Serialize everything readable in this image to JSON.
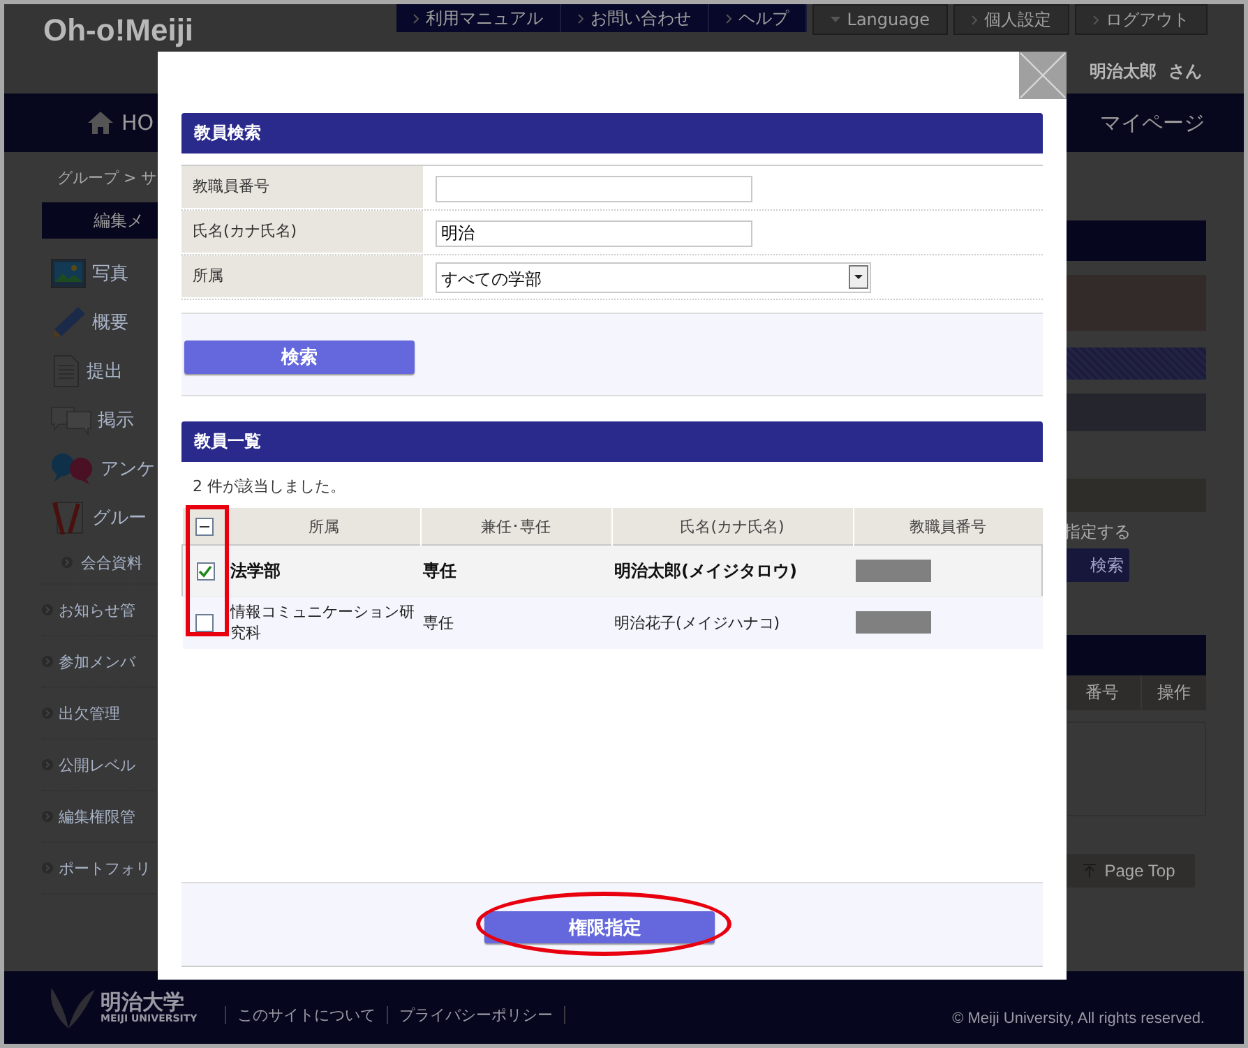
{
  "top_links": [
    {
      "label": "利用マニュアル",
      "kind": "link"
    },
    {
      "label": "お問い合わせ",
      "kind": "link"
    },
    {
      "label": "ヘルプ",
      "kind": "link"
    },
    {
      "label": "Language",
      "kind": "dropdown"
    },
    {
      "label": "個人設定",
      "kind": "link"
    },
    {
      "label": "ログアウト",
      "kind": "link"
    }
  ],
  "logo": "Oh-o!Meiji",
  "user_name": "明治太郎  さん",
  "nav": [
    {
      "label": "HO",
      "kind": "home"
    },
    {
      "label": "マイページ",
      "kind": "plain"
    }
  ],
  "breadcrumb": "グループ > サ",
  "sidebar": {
    "title": "編集メ",
    "items": [
      {
        "label": "写真",
        "kind": "photo"
      },
      {
        "label": "概要",
        "kind": "pencil"
      },
      {
        "label": "提出",
        "kind": "document"
      },
      {
        "label": "掲示",
        "kind": "chat"
      },
      {
        "label": "アンケ",
        "kind": "qa"
      },
      {
        "label": "グルー",
        "kind": "notebook"
      },
      {
        "label": "会合資料",
        "kind": "sub"
      },
      {
        "label": "お知らせ管",
        "kind": "bullet"
      },
      {
        "label": "参加メンバ",
        "kind": "bullet"
      },
      {
        "label": "出欠管理",
        "kind": "bullet"
      },
      {
        "label": "公開レベル",
        "kind": "bullet"
      },
      {
        "label": "編集権限管",
        "kind": "bullet"
      },
      {
        "label": "ポートフォリ",
        "kind": "bullet"
      }
    ]
  },
  "right_panel": {
    "note": "指定する",
    "button": "検索",
    "columns": [
      "番号",
      "操作"
    ],
    "page_top": "Page Top"
  },
  "modal": {
    "search": {
      "title": "教員検索",
      "fields": [
        {
          "label": "教職員番号",
          "kind": "text"
        },
        {
          "label": "氏名(カナ氏名)",
          "kind": "text",
          "value": "明治"
        },
        {
          "label": "所属",
          "kind": "select",
          "value": "すべての学部"
        }
      ],
      "button": "検索"
    },
    "results": {
      "title": "教員一覧",
      "count": "2 件が該当しました。",
      "select_all": {
        "indeterminate": true
      },
      "checkbox_column_highlighted": true,
      "columns": [
        "所属",
        "兼任･専任",
        "氏名(カナ氏名)",
        "教職員番号"
      ],
      "rows": [
        {
          "checked": true,
          "cells": [
            "法学部",
            "専任",
            "明治太郎(メイジタロウ)"
          ],
          "id_redacted": true
        },
        {
          "checked": false,
          "cells": [
            "情報コミュニケーション研究科",
            "専任",
            "明治花子(メイジハナコ)"
          ],
          "id_redacted": true
        }
      ]
    },
    "submit": {
      "label": "権限指定",
      "highlighted": true
    }
  },
  "footer": {
    "logo": "明治大学",
    "logo_sub": "MEIJI UNIVERSITY",
    "links": [
      "このサイトについて",
      "プライバシーポリシー"
    ],
    "copyright": "© Meiji University, All rights reserved."
  }
}
